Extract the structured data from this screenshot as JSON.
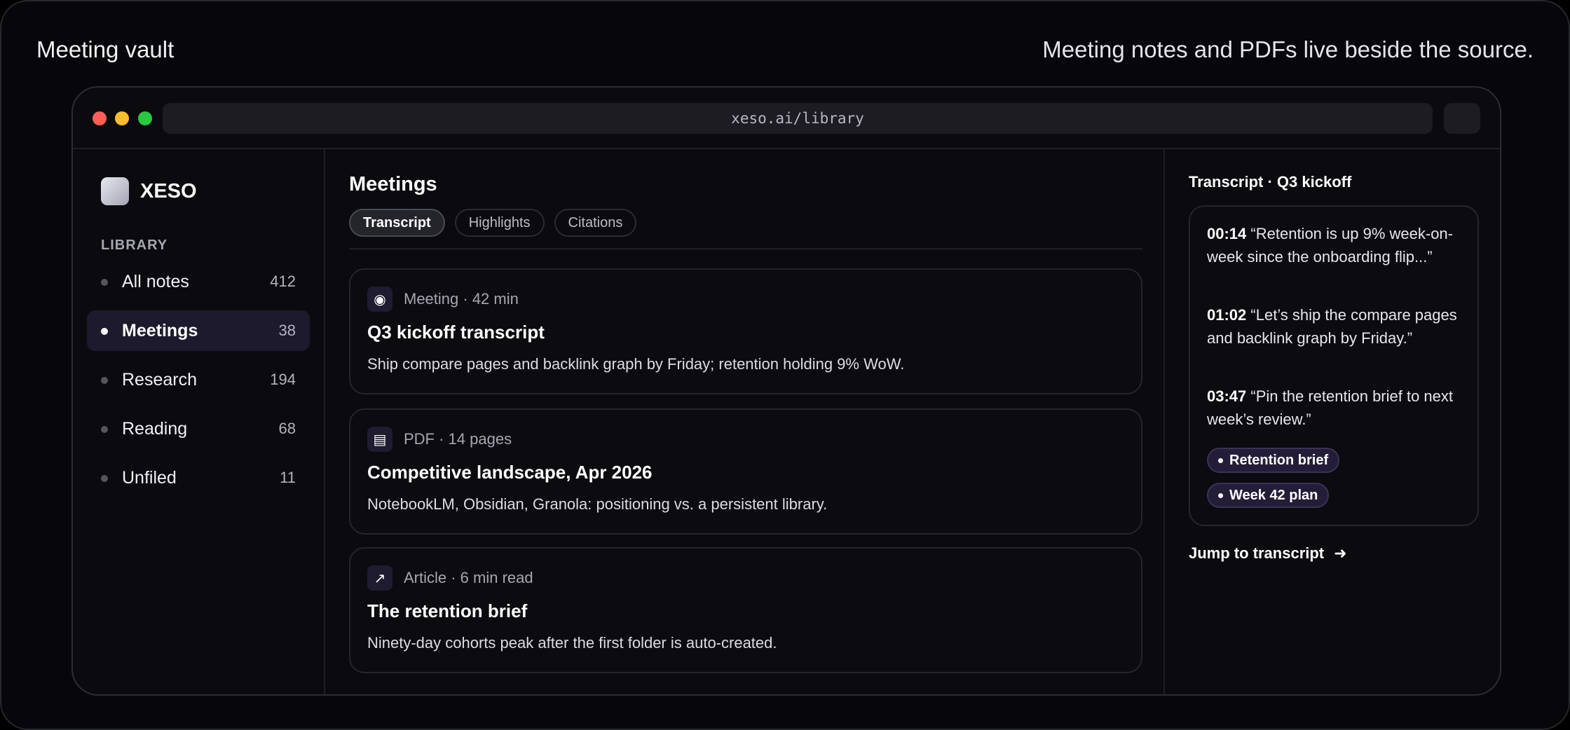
{
  "hero": {
    "title": "Meeting vault",
    "tagline": "Meeting notes and PDFs live beside the source."
  },
  "browser": {
    "url": "xeso.ai/library"
  },
  "sidebar": {
    "brand": "XESO",
    "section_label": "LIBRARY",
    "items": [
      {
        "label": "All notes",
        "count": "412",
        "active": false
      },
      {
        "label": "Meetings",
        "count": "38",
        "active": true
      },
      {
        "label": "Research",
        "count": "194",
        "active": false
      },
      {
        "label": "Reading",
        "count": "68",
        "active": false
      },
      {
        "label": "Unfiled",
        "count": "11",
        "active": false
      }
    ]
  },
  "main": {
    "title": "Meetings",
    "tabs": [
      {
        "label": "Transcript",
        "active": true
      },
      {
        "label": "Highlights",
        "active": false
      },
      {
        "label": "Citations",
        "active": false
      }
    ],
    "cards": [
      {
        "icon": "record-icon",
        "glyph": "◉",
        "meta": "Meeting · 42 min",
        "title": "Q3 kickoff transcript",
        "desc": "Ship compare pages and backlink graph by Friday; retention holding 9% WoW."
      },
      {
        "icon": "document-icon",
        "glyph": "▤",
        "meta": "PDF · 14 pages",
        "title": "Competitive landscape, Apr 2026",
        "desc": "NotebookLM, Obsidian, Granola: positioning vs. a persistent library."
      },
      {
        "icon": "external-link-icon",
        "glyph": "↗",
        "meta": "Article · 6 min read",
        "title": "The retention brief",
        "desc": "Ninety-day cohorts peak after the first folder is auto-created."
      }
    ]
  },
  "panel": {
    "title": "Transcript · Q3 kickoff",
    "quotes": [
      {
        "time": "00:14",
        "text": "“Retention is up 9% week-on-week since the onboarding flip...”"
      },
      {
        "time": "01:02",
        "text": "“Let’s ship the compare pages and backlink graph by Friday.”"
      },
      {
        "time": "03:47",
        "text": "“Pin the retention brief to next week’s review.”"
      }
    ],
    "chips": [
      "Retention brief",
      "Week 42 plan"
    ],
    "jump_label": "Jump to transcript",
    "jump_arrow": "➜"
  }
}
